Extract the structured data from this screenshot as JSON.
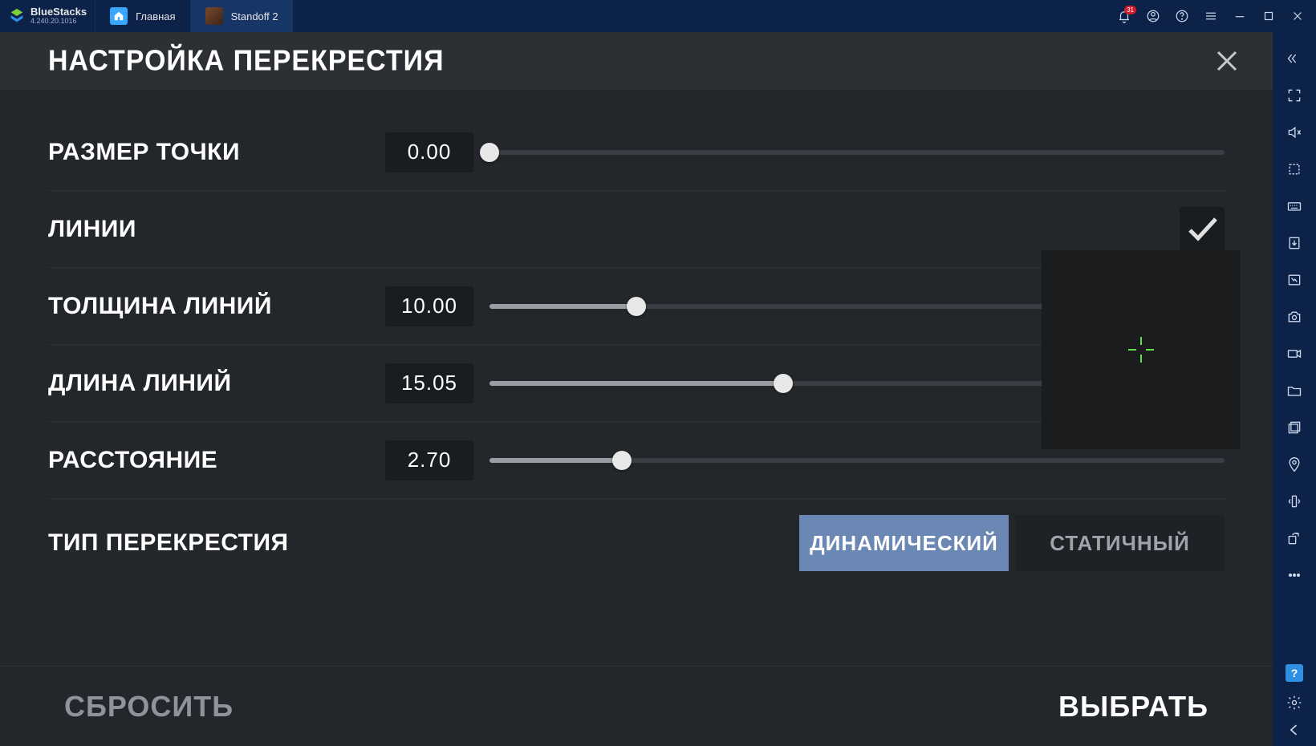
{
  "app": {
    "name": "BlueStacks",
    "version": "4.240.20.1016",
    "notif_count": "31"
  },
  "tabs": {
    "home_label": "Главная",
    "game_label": "Standoff 2"
  },
  "panel": {
    "title": "НАСТРОЙКА ПЕРЕКРЕСТИЯ"
  },
  "settings": {
    "dot_size": {
      "label": "РАЗМЕР ТОЧКИ",
      "value": "0.00",
      "pct": 0
    },
    "lines": {
      "label": "ЛИНИИ",
      "checked": true
    },
    "thickness": {
      "label": "ТОЛЩИНА ЛИНИЙ",
      "value": "10.00",
      "pct": 20
    },
    "length": {
      "label": "ДЛИНА ЛИНИЙ",
      "value": "15.05",
      "pct": 40
    },
    "gap": {
      "label": "РАССТОЯНИЕ",
      "value": "2.70",
      "pct": 18
    },
    "type": {
      "label": "ТИП ПЕРЕКРЕСТИЯ",
      "option_dynamic": "ДИНАМИЧЕСКИЙ",
      "option_static": "СТАТИЧНЫЙ",
      "selected": "dynamic"
    }
  },
  "footer": {
    "reset": "СБРОСИТЬ",
    "select": "ВЫБРАТЬ"
  }
}
